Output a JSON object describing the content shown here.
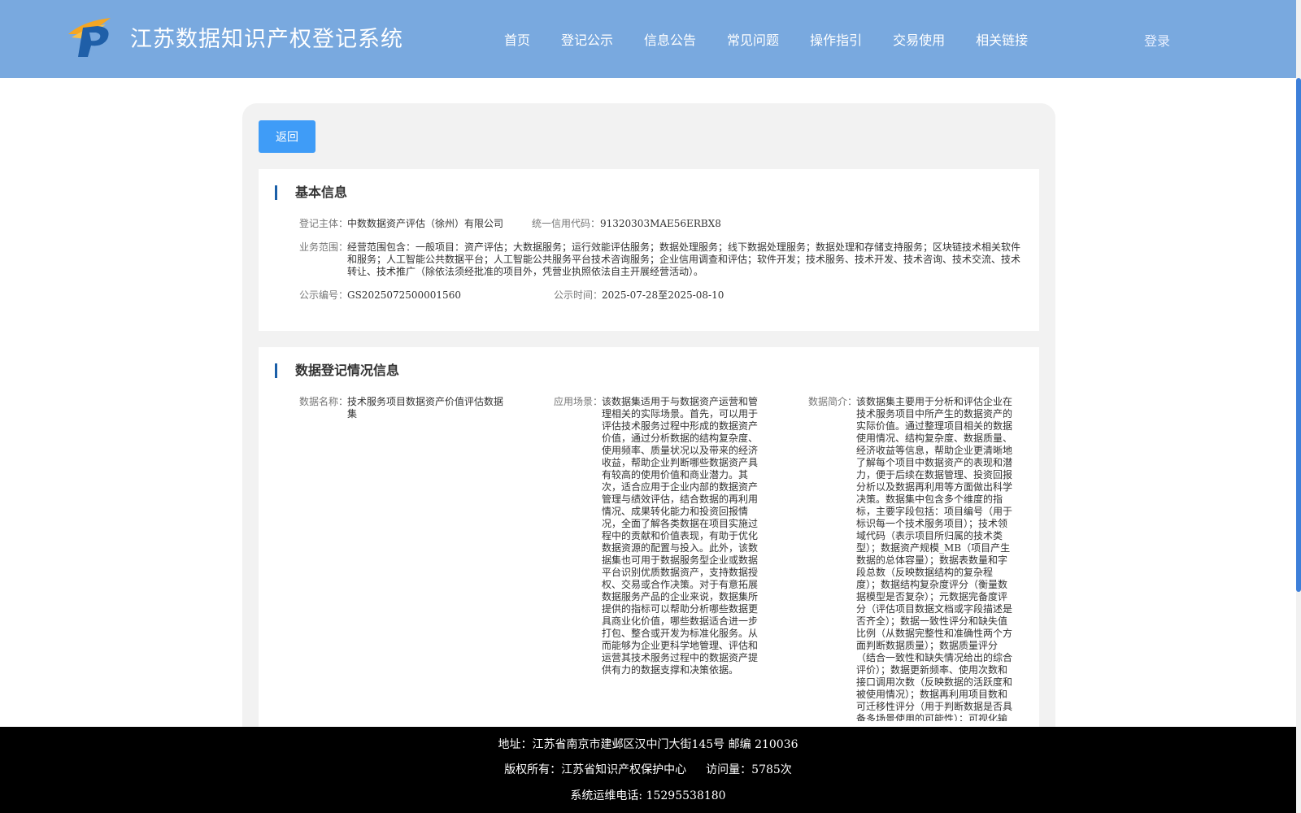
{
  "header": {
    "title": "江苏数据知识产权登记系统",
    "nav": [
      "首页",
      "登记公示",
      "信息公告",
      "常见问题",
      "操作指引",
      "交易使用",
      "相关链接"
    ],
    "login": "登录",
    "logo_colors": {
      "orange": "#f5a623",
      "blue": "#1f5fa8"
    }
  },
  "panel": {
    "back_label": "返回"
  },
  "basic_info": {
    "title": "基本信息",
    "subject_label": "登记主体：",
    "subject_value": "中数数据资产评估（徐州）有限公司",
    "credit_label": "统一信用代码：",
    "credit_value": "91320303MAE56ERBX8",
    "scope_label": "业务范围：",
    "scope_value": "经营范围包含：一般项目：资产评估；大数据服务；运行效能评估服务；数据处理服务；线下数据处理服务；数据处理和存储支持服务；区块链技术相关软件和服务；人工智能公共数据平台；人工智能公共服务平台技术咨询服务；企业信用调查和评估；软件开发；技术服务、技术开发、技术咨询、技术交流、技术转让、技术推广（除依法须经批准的项目外，凭营业执照依法自主开展经营活动）。",
    "pub_no_label": "公示编号：",
    "pub_no_value": "GS2025072500001560",
    "pub_time_label": "公示时间：",
    "pub_time_value": "2025-07-28至2025-08-10"
  },
  "data_info": {
    "title": "数据登记情况信息",
    "name_label": "数据名称：",
    "name_value": "技术服务项目数据资产价值评估数据集",
    "scene_label": "应用场景：",
    "scene_value": "该数据集适用于与数据资产运营和管理相关的实际场景。首先，可以用于评估技术服务过程中形成的数据资产价值，通过分析数据的结构复杂度、使用频率、质量状况以及带来的经济收益，帮助企业判断哪些数据资产具有较高的使用价值和商业潜力。其次，适合应用于企业内部的数据资产管理与绩效评估，结合数据的再利用情况、成果转化能力和投资回报情况，全面了解各类数据在项目实施过程中的贡献和价值表现，有助于优化数据资源的配置与投入。此外，该数据集也可用于数据服务型企业或数据平台识别优质数据资产，支持数据授权、交易或合作决策。对于有意拓展数据服务产品的企业来说，数据集所提供的指标可以帮助分析哪些数据更具商业化价值，哪些数据适合进一步打包、整合或开发为标准化服务。从而能够为企业更科学地管理、评估和运营其技术服务过程中的数据资产提供有力的数据支撑和决策依据。",
    "intro_label": "数据简介：",
    "intro_value": "该数据集主要用于分析和评估企业在技术服务项目中所产生的数据资产的实际价值。通过整理项目相关的数据使用情况、结构复杂度、数据质量、经济收益等信息，帮助企业更清晰地了解每个项目中数据资产的表现和潜力，便于后续在数据管理、投资回报分析以及数据再利用等方面做出科学决策。数据集中包含多个维度的指标，主要字段包括：项目编号（用于标识每一个技术服务项目）；技术领域代码（表示项目所归属的技术类型）；数据资产规模_MB（项目产生数据的总体容量）；数据表数量和字段总数（反映数据结构的复杂程度）；数据结构复杂度评分（衡量数据模型是否复杂）；元数据完备度评分（评估项目数据文档或字段描述是否齐全）；数据一致性评分和缺失值比例（从数据完整性和准确性两个方面判断数据质量）；数据质量评分（结合一致性和缺失情况给出的综合评价）；数据更新频率、使用次数和接口调用次数（反映数据的活跃度和被使用情况）；数据再利用项目数和可迁移性评分（用于判断数据是否具备多场景使用的可能性）；可视化输出"
  },
  "footer": {
    "address": "地址：江苏省南京市建邺区汉中门大街145号 邮编 210036",
    "copyright": "版权所有：江苏省知识产权保护中心",
    "visits": "访问量：5785次",
    "phone": "系统运维电话: 15295538180"
  }
}
